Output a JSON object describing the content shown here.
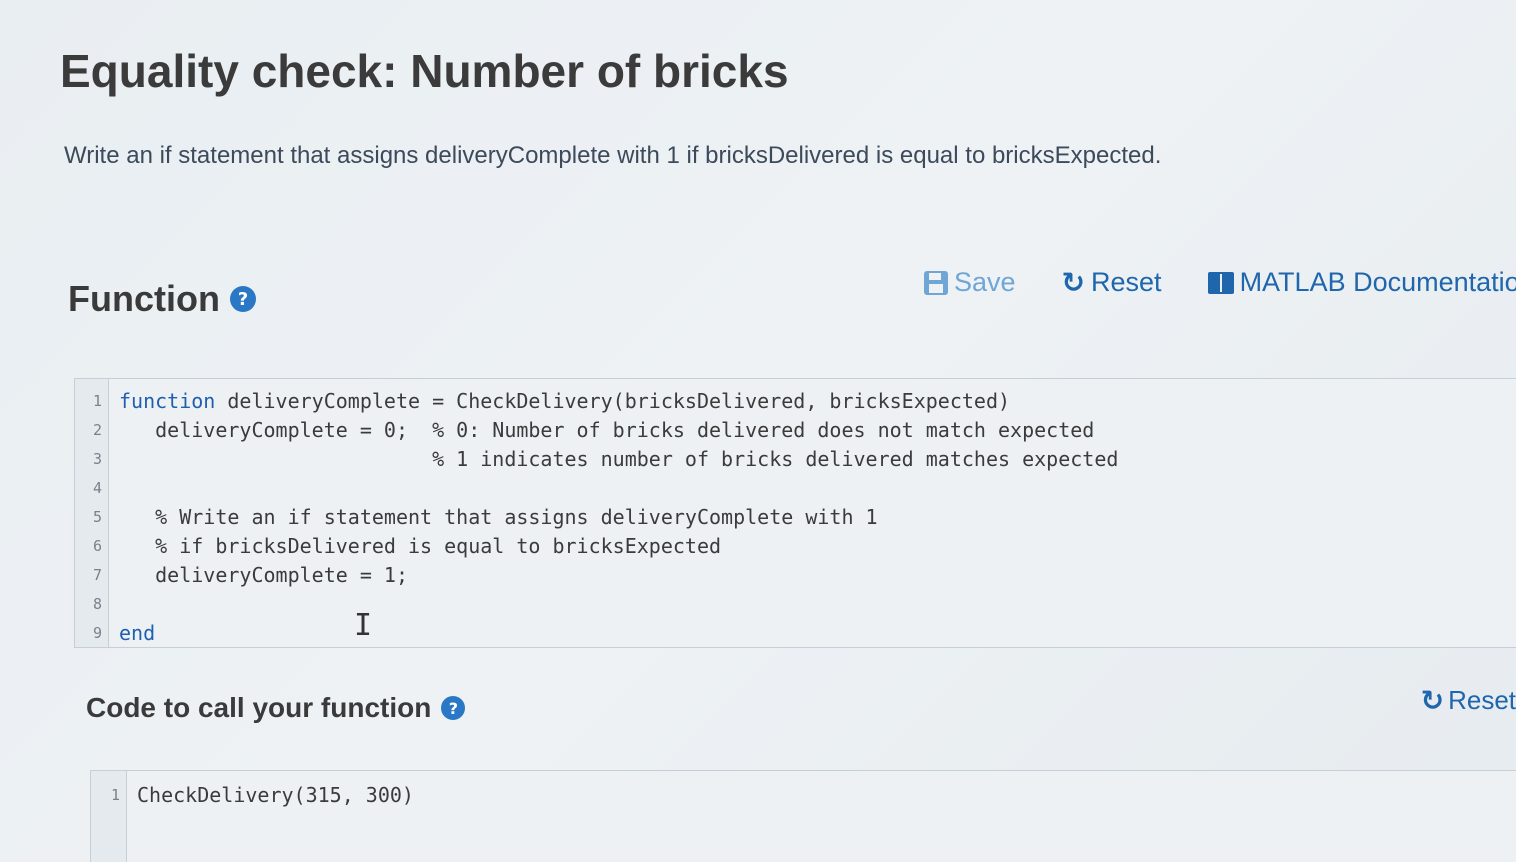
{
  "page": {
    "title": "Equality check: Number of bricks",
    "description": "Write an if statement that assigns deliveryComplete with 1 if bricksDelivered is equal to bricksExpected."
  },
  "function_section": {
    "heading": "Function",
    "help_icon": "?",
    "toolbar": {
      "save_label": "Save",
      "reset_label": "Reset",
      "docs_label": "MATLAB Documentation",
      "save_icon": "save-icon",
      "reset_icon": "reset-icon",
      "docs_icon": "book-icon"
    },
    "line_numbers": [
      "1",
      "2",
      "3",
      "4",
      "5",
      "6",
      "7",
      "8",
      "9"
    ],
    "code_lines": [
      {
        "kw": "function",
        "text": " deliveryComplete = CheckDelivery(bricksDelivered, bricksExpected)"
      },
      {
        "kw": "",
        "text": "   deliveryComplete = 0;  % 0: Number of bricks delivered does not match expected"
      },
      {
        "kw": "",
        "text": "                          % 1 indicates number of bricks delivered matches expected"
      },
      {
        "kw": "",
        "text": ""
      },
      {
        "kw": "",
        "text": "   % Write an if statement that assigns deliveryComplete with 1"
      },
      {
        "kw": "",
        "text": "   % if bricksDelivered is equal to bricksExpected"
      },
      {
        "kw": "",
        "text": "   deliveryComplete = 1;"
      },
      {
        "kw": "",
        "text": ""
      },
      {
        "kw": "end",
        "text": ""
      }
    ]
  },
  "call_section": {
    "heading": "Code to call your function",
    "help_icon": "?",
    "reset_label": "Reset",
    "line_numbers": [
      "1"
    ],
    "code_lines": [
      "CheckDelivery(315, 300)"
    ]
  },
  "colors": {
    "accent": "#1f66ac",
    "help_icon": "#2a78c5",
    "save_disabled": "#6fa6d6"
  }
}
